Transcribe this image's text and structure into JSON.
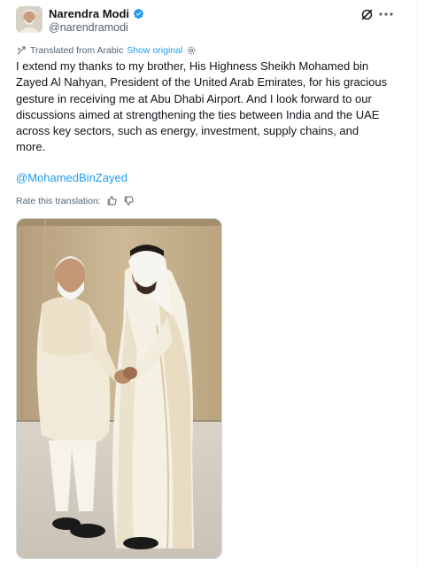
{
  "author": {
    "display_name": "Narendra Modi",
    "handle": "@narendramodi",
    "verified": true
  },
  "header_icons": {
    "grok": "grok-icon",
    "more": "more-dots-icon"
  },
  "translation": {
    "label": "Translated from Arabic",
    "show_original": "Show original"
  },
  "tweet": {
    "text": "I extend my thanks to my brother, His Highness Sheikh Mohamed bin\nZayed Al Nahyan, President of the United Arab Emirates, for his gracious\ngesture in receiving me at Abu Dhabi Airport. And I look forward to our\ndiscussions aimed at strengthening the ties between India and the UAE\nacross key sectors, such as energy, investment, supply chains, and\nmore.",
    "mention": "@MohamedBinZayed"
  },
  "rating": {
    "label": "Rate this translation:"
  },
  "media": {
    "kind": "photo"
  },
  "colors": {
    "link": "#1d9bf0",
    "secondary_text": "#536471",
    "verified_badge": "#1d9bf0"
  }
}
